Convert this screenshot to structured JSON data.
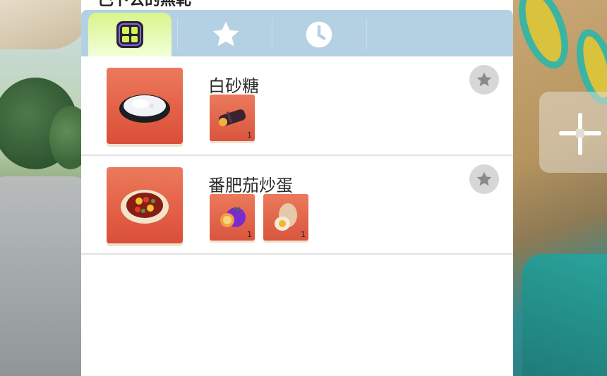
{
  "panel": {
    "title": "巴卜公的無軋",
    "tabs": [
      {
        "name": "all",
        "icon": "category-grid-icon",
        "active": true
      },
      {
        "name": "favorites",
        "icon": "star-icon",
        "active": false
      },
      {
        "name": "recent",
        "icon": "clock-icon",
        "active": false
      }
    ]
  },
  "recipes": [
    {
      "name": "白砂糖",
      "dish_icon": "sugar-bowl-icon",
      "favorited": false,
      "ingredients": [
        {
          "icon": "sugarcane-icon",
          "qty": "1"
        }
      ]
    },
    {
      "name": "番肥茄炒蛋",
      "dish_icon": "tomato-egg-plate-icon",
      "favorited": false,
      "ingredients": [
        {
          "icon": "tomato-icon",
          "qty": "1"
        },
        {
          "icon": "egg-icon",
          "qty": "1"
        }
      ]
    }
  ],
  "colors": {
    "tab_bar": "#b4d1e3",
    "active_tab": "#d8f58a",
    "item_tile": "#e25f44",
    "fav_button": "#d7d7d7"
  }
}
